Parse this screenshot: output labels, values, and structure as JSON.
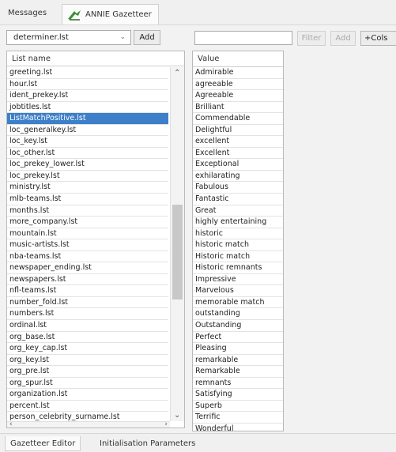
{
  "top_tabs": {
    "messages": "Messages",
    "annie": "ANNIE Gazetteer"
  },
  "left": {
    "list_select_value": "determiner.lst",
    "add_label": "Add",
    "column_header": "List name",
    "selected_index": 4,
    "items": [
      "greeting.lst",
      "hour.lst",
      "ident_prekey.lst",
      "jobtitles.lst",
      "ListMatchPositive.lst",
      "loc_generalkey.lst",
      "loc_key.lst",
      "loc_other.lst",
      "loc_prekey_lower.lst",
      "loc_prekey.lst",
      "ministry.lst",
      "mlb-teams.lst",
      "months.lst",
      "more_company.lst",
      "mountain.lst",
      "music-artists.lst",
      "nba-teams.lst",
      "newspaper_ending.lst",
      "newspapers.lst",
      "nfl-teams.lst",
      "number_fold.lst",
      "numbers.lst",
      "ordinal.lst",
      "org_base.lst",
      "org_key_cap.lst",
      "org_key.lst",
      "org_pre.lst",
      "org_spur.lst",
      "organization.lst",
      "percent.lst",
      "person_celebrity_surname.lst"
    ]
  },
  "right": {
    "filter_label": "Filter",
    "add_label": "Add",
    "add_cols_label": "+Cols",
    "column_header": "Value",
    "values": [
      "Admirable",
      "agreeable",
      "Agreeable",
      "Brilliant",
      "Commendable",
      "Delightful",
      "excellent",
      "Excellent",
      "Exceptional",
      "exhilarating",
      "Fabulous",
      "Fantastic",
      "Great",
      "highly entertaining",
      "historic",
      "historic match",
      "Historic match",
      "Historic remnants",
      "Impressive",
      "Marvelous",
      "memorable match",
      "outstanding",
      "Outstanding",
      "Perfect",
      "Pleasing",
      "remarkable",
      "Remarkable",
      "remnants",
      "Satisfying",
      "Superb",
      "Terrific",
      "Wonderful"
    ]
  },
  "bottom_tabs": {
    "editor": "Gazetteer Editor",
    "params": "Initialisation Parameters"
  },
  "colors": {
    "selection": "#3d7fc9",
    "icon_green": "#3f8f3a"
  }
}
